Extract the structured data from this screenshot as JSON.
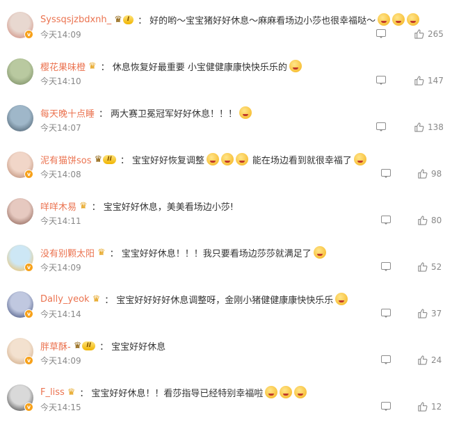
{
  "comments": [
    {
      "user": "Syssqsjzbdxnh_",
      "crown": false,
      "level": "I",
      "text": "好的哟～宝宝猪好好休息～麻麻看场边小莎也很幸福哒～",
      "emoji_count": 3,
      "time": "今天14:09",
      "likes": "265",
      "avatar_colors": [
        "#e8d8d0",
        "#c97a6a"
      ],
      "verified": true
    },
    {
      "user": "樱花果味橙",
      "crown": true,
      "level": "",
      "text": "休息恢复好最重要 小宝健健康康快快乐乐的",
      "emoji_count": 1,
      "time": "今天14:10",
      "likes": "147",
      "avatar_colors": [
        "#b9c9a0",
        "#6c7f57"
      ],
      "verified": false
    },
    {
      "user": "每天晚十点睡",
      "crown": false,
      "level": "",
      "text": "两大赛卫冕冠军好好休息！！！",
      "emoji_count": 1,
      "time": "今天14:07",
      "likes": "138",
      "avatar_colors": [
        "#9fb7c9",
        "#3c4f5e"
      ],
      "verified": false
    },
    {
      "user": "泥有猫饼sos",
      "crown": false,
      "level": "II",
      "text": "宝宝好好恢复调整",
      "text2": "能在场边看到就很幸福了",
      "emoji_count": 3,
      "time": "今天14:08",
      "likes": "98",
      "avatar_colors": [
        "#f1d6c8",
        "#b07a60"
      ],
      "verified": true
    },
    {
      "user": "咩咩木易",
      "crown": true,
      "level": "",
      "text": "宝宝好好休息，美美看场边小莎!",
      "emoji_count": 0,
      "time": "今天14:11",
      "likes": "80",
      "avatar_colors": [
        "#e6c9c0",
        "#7a4d40"
      ],
      "verified": false
    },
    {
      "user": "没有别颗太阳",
      "crown": true,
      "level": "",
      "text": "宝宝好好休息！！！我只要看场边莎莎就满足了",
      "emoji_count": 1,
      "time": "今天14:09",
      "likes": "52",
      "avatar_colors": [
        "#cde7f5",
        "#f2b84a"
      ],
      "verified": true
    },
    {
      "user": "Dally_yeok",
      "crown": true,
      "level": "",
      "text": "宝宝好好好好休息调整呀，金刚小猪健健康康快快乐乐",
      "emoji_count": 1,
      "time": "今天14:14",
      "likes": "37",
      "avatar_colors": [
        "#c0c8e0",
        "#2b3a6a"
      ],
      "verified": true
    },
    {
      "user": "胖草酥-",
      "crown": false,
      "level": "II",
      "text": "宝宝好好休息",
      "emoji_count": 0,
      "time": "今天14:09",
      "likes": "24",
      "avatar_colors": [
        "#f3e1cf",
        "#c9a078"
      ],
      "verified": true
    },
    {
      "user": "F_liss",
      "crown": true,
      "level": "",
      "text": "宝宝好好休息！！看莎指导已经特别幸福啦",
      "emoji_count": 3,
      "time": "今天14:15",
      "likes": "12",
      "avatar_colors": [
        "#d9d9d9",
        "#2a2a2a"
      ],
      "verified": true
    }
  ],
  "colon": "：",
  "verified_mark": "v",
  "icons": {
    "reply": "comment-icon",
    "like": "thumb-up-icon",
    "crown": "crown-icon"
  },
  "colors": {
    "username": "#eb7350",
    "meta": "#888888",
    "text": "#333333"
  }
}
